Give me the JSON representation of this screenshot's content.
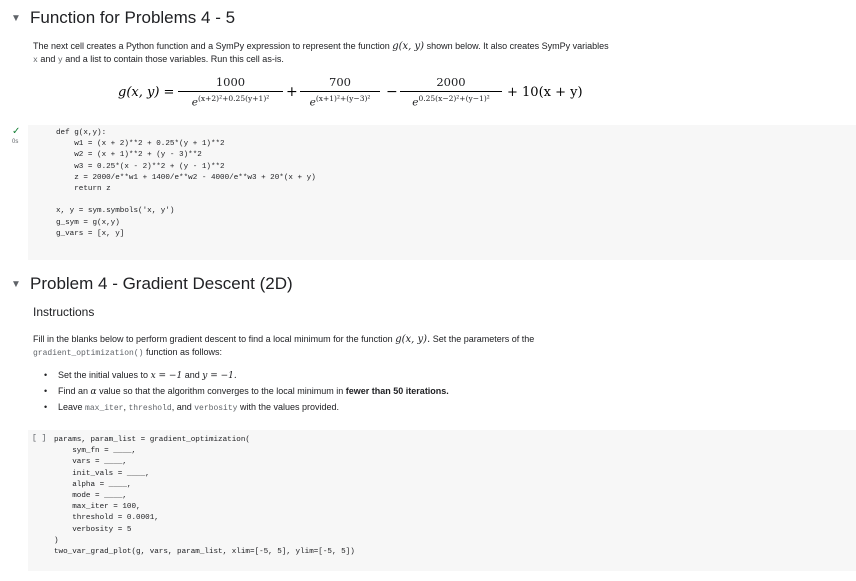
{
  "section1": {
    "title": "Function for Problems 4 - 5",
    "description_1": "The next cell creates a Python function and a SymPy expression to represent the function",
    "description_math": "g(x, y)",
    "description_2": "shown below. It also creates SymPy variables",
    "description_3a": "x",
    "description_3b": "and",
    "description_3c": "y",
    "description_3d": "and a list to contain those variables. Run this cell as-is."
  },
  "equation": {
    "lhs": "g(x, y) =",
    "t1_num": "1000",
    "t1_den": "(x+2)²+0.25(y+1)²",
    "op1": "+",
    "t2_num": "700",
    "t2_den": "(x+1)²+(y−3)²",
    "op2": "−",
    "t3_num": "2000",
    "t3_den": "0.25(x−2)²+(y−1)²",
    "tail": "+ 10(x + y)",
    "base": "e"
  },
  "cell1": {
    "status": "✓",
    "exec": "0s",
    "lines": [
      "def g(x,y):",
      "    w1 = (x + 2)**2 + 0.25*(y + 1)**2",
      "    w2 = (x + 1)**2 + (y - 3)**2",
      "    w3 = 0.25*(x - 2)**2 + (y - 1)**2",
      "    z = 2000/e**w1 + 1400/e**w2 - 4000/e**w3 + 20*(x + y)",
      "    return z",
      "",
      "x, y = sym.symbols('x, y')",
      "g_sym = g(x,y)",
      "g_vars = [x, y]"
    ]
  },
  "section2": {
    "title": "Problem 4 - Gradient Descent (2D)",
    "subtitle": "Instructions",
    "intro_1": "Fill in the blanks below to perform gradient descent to find a local minimum for the function",
    "intro_math": "g(x, y).",
    "intro_2": "Set the parameters of the",
    "intro_code": "gradient_optimization()",
    "intro_3": "function as follows:",
    "bullet1_a": "Set the initial values to",
    "bullet1_b": "x = −1",
    "bullet1_c": "and",
    "bullet1_d": "y = −1.",
    "bullet2_a": "Find an",
    "bullet2_b": "α",
    "bullet2_c": "value so that the algorithm converges to the local minimum in",
    "bullet2_d": "fewer than 50 iterations.",
    "bullet3_a": "Leave",
    "bullet3_b": "max_iter",
    "bullet3_c": ",",
    "bullet3_d": "threshold",
    "bullet3_e": ", and",
    "bullet3_f": "verbosity",
    "bullet3_g": "with the values provided."
  },
  "cell2": {
    "bracket": "[ ]",
    "lines": [
      "params, param_list = gradient_optimization(",
      "    sym_fn = ____,",
      "    vars = ____,",
      "    init_vals = ____,",
      "    alpha = ____,",
      "    mode = ____,",
      "    max_iter = 100,",
      "    threshold = 0.0001,",
      "    verbosity = 5",
      ")",
      "two_var_grad_plot(g, vars, param_list, xlim=[-5, 5], ylim=[-5, 5])"
    ]
  }
}
